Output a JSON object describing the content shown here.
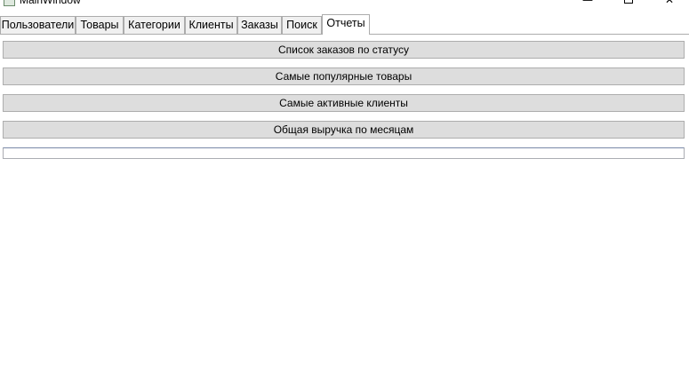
{
  "window": {
    "title": "MainWindow",
    "controls": {
      "minimize_glyph": "—",
      "close_glyph": "✕"
    }
  },
  "tabs": [
    {
      "label": "Пользователи",
      "selected": false
    },
    {
      "label": "Товары",
      "selected": false
    },
    {
      "label": "Категории",
      "selected": false
    },
    {
      "label": "Клиенты",
      "selected": false
    },
    {
      "label": "Заказы",
      "selected": false
    },
    {
      "label": "Поиск",
      "selected": false
    },
    {
      "label": "Отчеты",
      "selected": true
    }
  ],
  "reports": {
    "buttons": [
      {
        "label": "Список заказов по статусу"
      },
      {
        "label": "Самые популярные товары"
      },
      {
        "label": "Самые активные клиенты"
      },
      {
        "label": "Общая выручка по месяцам"
      }
    ],
    "result_value": ""
  }
}
